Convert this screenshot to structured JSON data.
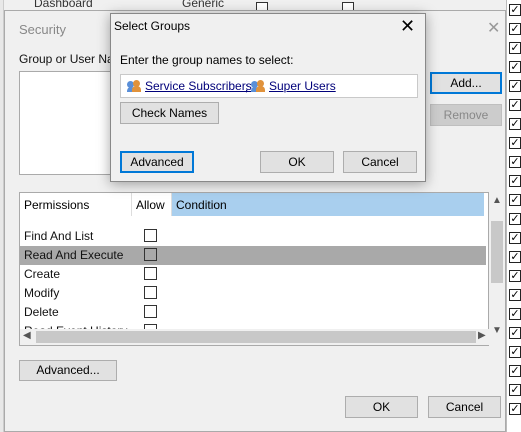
{
  "background_list": {
    "row_label": "Dashboard",
    "type_label": "Generic"
  },
  "security_window": {
    "title": "Security",
    "group_or_user_label": "Group or User Na",
    "add_button": "Add...",
    "remove_button": "Remove",
    "permissions": {
      "columns": [
        "Permissions",
        "Allow",
        "Condition"
      ],
      "rows": [
        {
          "name": "Find And List",
          "allow": false,
          "selected": false
        },
        {
          "name": "Read And Execute",
          "allow": false,
          "selected": true
        },
        {
          "name": "Create",
          "allow": false,
          "selected": false
        },
        {
          "name": "Modify",
          "allow": false,
          "selected": false
        },
        {
          "name": "Delete",
          "allow": false,
          "selected": false
        },
        {
          "name": "Read Event History",
          "allow": false,
          "selected": false
        }
      ]
    },
    "advanced_button": "Advanced...",
    "ok_button": "OK",
    "cancel_button": "Cancel"
  },
  "select_groups_dialog": {
    "title": "Select Groups",
    "prompt": "Enter the group names to select:",
    "names": [
      "Service Subscribers",
      "Super Users"
    ],
    "separator": ";",
    "check_names_button": "Check Names",
    "advanced_button": "Advanced",
    "ok_button": "OK",
    "cancel_button": "Cancel"
  },
  "colors": {
    "header_highlight": "#a9cfee",
    "selected_row": "#a9a9a9",
    "focus_border": "#0078d7",
    "link": "#00007a"
  }
}
